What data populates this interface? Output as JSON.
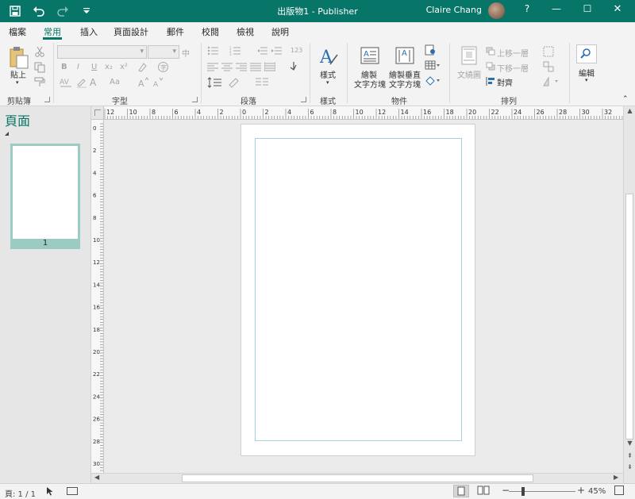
{
  "titlebar": {
    "title": "出版物1  -  Publisher",
    "user": "Claire Chang",
    "help": "?",
    "minimize": "—",
    "maximize": "☐",
    "close": "✕"
  },
  "tabs": [
    "檔案",
    "常用",
    "插入",
    "頁面設計",
    "郵件",
    "校閱",
    "檢視",
    "說明"
  ],
  "active_tab": "常用",
  "ribbon": {
    "groups": {
      "clipboard": "剪貼簿",
      "font": "字型",
      "paragraph": "段落",
      "styles": "樣式",
      "objects": "物件",
      "arrange": "排列"
    },
    "paste": "貼上",
    "styles_button": "樣式",
    "draw_textbox": [
      "繪製",
      "文字方塊"
    ],
    "draw_vertical_textbox": [
      "繪製垂直",
      "文字方塊"
    ],
    "wrap_text": "文繞圖",
    "bring_forward": "上移一層",
    "send_backward": "下移一層",
    "align": "對齊",
    "editing": "編輯",
    "font_size_label": "中",
    "numbering_label": "123",
    "bold": "B",
    "italic": "I",
    "underline": "U",
    "subscript": "x₂",
    "superscript": "x²",
    "font_color_label": "A",
    "change_case": "Aa"
  },
  "pages_pane": {
    "title": "頁面",
    "thumbnail_number": "1"
  },
  "hruler_labels": [
    "12",
    "10",
    "8",
    "6",
    "4",
    "2",
    "0",
    "2",
    "4",
    "6",
    "8",
    "10",
    "12",
    "14",
    "16",
    "18",
    "20",
    "22",
    "24",
    "26",
    "28",
    "30",
    "32"
  ],
  "vruler_labels": [
    "0",
    "2",
    "4",
    "6",
    "8",
    "10",
    "12",
    "14",
    "16",
    "18",
    "20",
    "22",
    "24",
    "26",
    "28",
    "30"
  ],
  "statusbar": {
    "page": "頁: 1 / 1",
    "zoom": "45%",
    "zoom_percent": 45
  },
  "colors": {
    "accent": "#077568",
    "margin_guide": "#a9cfe5",
    "thumb_frame": "#9ccbc3"
  }
}
